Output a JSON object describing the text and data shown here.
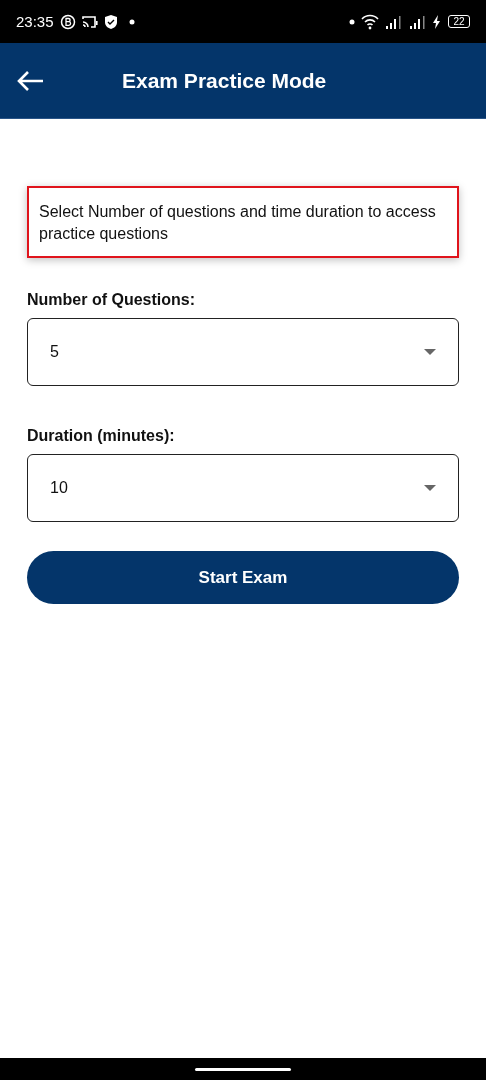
{
  "status_bar": {
    "time": "23:35",
    "battery": "22"
  },
  "app_bar": {
    "title": "Exam Practice Mode"
  },
  "notice": "Select Number of questions and time duration to access practice questions",
  "fields": [
    {
      "label": "Number of Questions:",
      "value": "5"
    },
    {
      "label": "Duration (minutes):",
      "value": "10"
    }
  ],
  "start_button": "Start Exam"
}
